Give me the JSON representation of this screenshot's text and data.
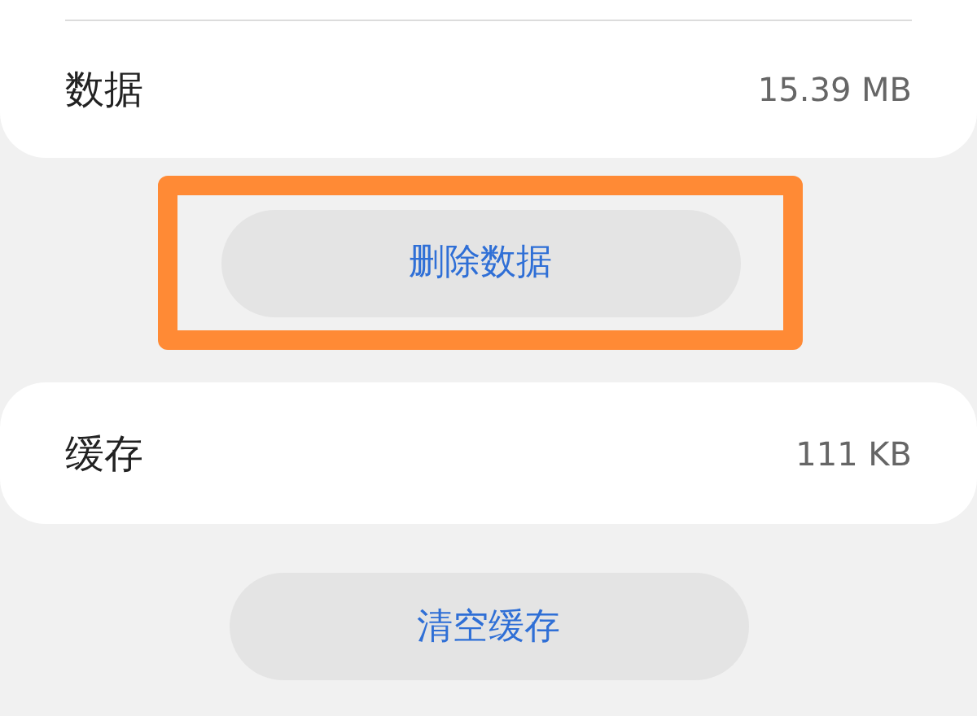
{
  "storage_items": [
    {
      "label": "数据",
      "value": "15.39 MB",
      "button": {
        "label": "删除数据",
        "highlighted": true
      }
    },
    {
      "label": "缓存",
      "value": "111 KB",
      "button": {
        "label": "清空缓存",
        "highlighted": false
      }
    }
  ]
}
